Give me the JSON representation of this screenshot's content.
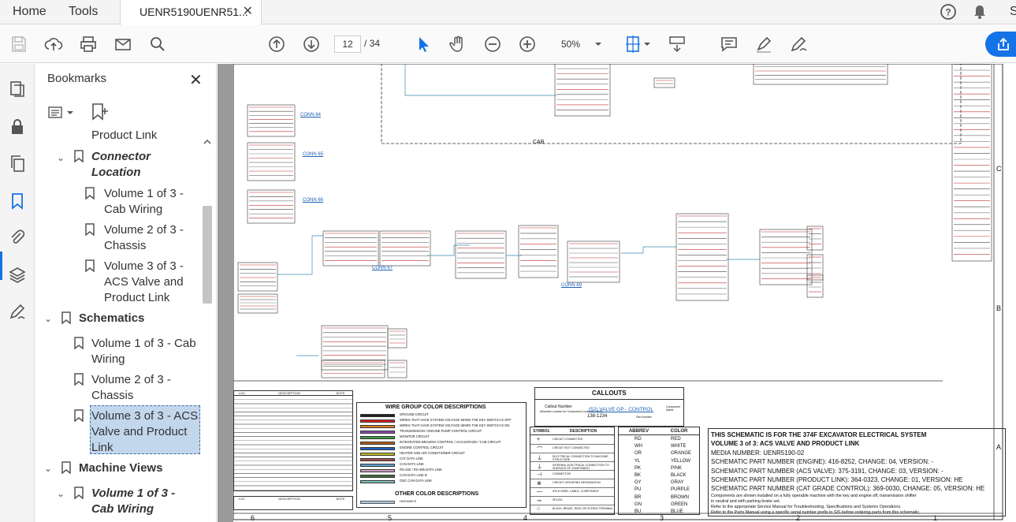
{
  "tabs": {
    "home": "Home",
    "tools": "Tools",
    "document": "UENR5190UENR51...",
    "close": "✕",
    "user_initial": "S"
  },
  "toolbar": {
    "page_current": "12",
    "page_total": "/ 34",
    "zoom": "50%"
  },
  "bookmarks": {
    "title": "Bookmarks",
    "close": "✕",
    "items": [
      {
        "label": "Product Link",
        "level": 2
      },
      {
        "label": "Connector Location",
        "level": 1
      },
      {
        "label": "Volume 1 of 3 - Cab Wiring",
        "level": 2
      },
      {
        "label": "Volume 2 of 3 - Chassis",
        "level": 2
      },
      {
        "label": "Volume 3 of 3 - ACS Valve and Product Link",
        "level": 2
      },
      {
        "label": "Schematics",
        "level": 0
      },
      {
        "label": "Volume 1 of 3 - Cab Wiring",
        "level": 1
      },
      {
        "label": "Volume 2 of 3 - Chassis",
        "level": 1
      },
      {
        "label": "Volume 3 of 3 - ACS Valve and Product Link",
        "level": 1
      },
      {
        "label": "Machine Views",
        "level": 0
      },
      {
        "label": "Volume 1 of 3 - Cab Wiring",
        "level": 1
      }
    ]
  },
  "schematic": {
    "cab_label": "CAB",
    "conn_labels": [
      "CONN 64",
      "CONN 65",
      "CONN 66",
      "CONN 67",
      "CONN 69"
    ],
    "wire_group_title": "WIRE GROUP COLOR DESCRIPTIONS",
    "wire_groups": [
      "GROUND CIRCUIT",
      "WIRES THAT HAVE SYSTEM VOLTAGE WHEN THE KEY SWITCH IS OFF",
      "WIRES THAT HAVE SYSTEM VOLTAGE WHEN THE KEY SWITCH IS ON",
      "TRANSMISSION / ENGINE PUMP CONTROL CIRCUIT",
      "MONITOR CIRCUIT",
      "INTEGRATED BRAKING CONTROL / ACCUGRADE / CAB CIRCUIT",
      "ENGINE CONTROL CIRCUIT",
      "HEATER AND AIR CONDITIONER CIRCUIT",
      "CAT DATA LINK",
      "CAN DATA LINK",
      "RS-232 / RS-485 DATA LINK",
      "CAN DATA LINK B",
      "OSC CAN DATA LINK"
    ],
    "other_color_title": "OTHER COLOR DESCRIPTIONS",
    "other_colors": [
      "HIGHWAYS"
    ],
    "callouts_title": "CALLOUTS",
    "callout_number": "Callout Number",
    "callout_sub": "(Machine Location for Component Locations Table)",
    "callout_example": "(52) VALVE GP - CONTROL",
    "callout_part": "138-1234",
    "callout_part_label": "Part Number",
    "callout_component": "Component Name",
    "symbol_headers": [
      "SYMBOL",
      "DESCRIPTION"
    ],
    "symbols": [
      "CIRCUIT CONNECTED",
      "CIRCUIT NOT CONNECTED",
      "ELECTRICAL CONNECTION TO MACHINE STRUCTURE",
      "INTERNAL ELECTRICAL CONNECTION TO SURFACE OF COMPONENT",
      "CONNECTOR",
      "CIRCUIT GROUPING DESIGNATION",
      "ATCH WIRE, CABLE, COMPONENT",
      "SPLICE",
      "BLACK, BRAZE, RING OR SCREW TERMINAL"
    ],
    "abbrev_headers": [
      "ABBREV",
      "COLOR"
    ],
    "abbrevs": [
      [
        "RD",
        "RED"
      ],
      [
        "WH",
        "WHITE"
      ],
      [
        "OR",
        "ORANGE"
      ],
      [
        "YL",
        "YELLOW"
      ],
      [
        "PK",
        "PINK"
      ],
      [
        "BK",
        "BLACK"
      ],
      [
        "GY",
        "GRAY"
      ],
      [
        "PU",
        "PURPLE"
      ],
      [
        "BR",
        "BROWN"
      ],
      [
        "GN",
        "GREEN"
      ],
      [
        "BU",
        "BLUE"
      ]
    ],
    "info_lines": [
      "THIS SCHEMATIC IS FOR THE 374F EXCAVATOR ELECTRICAL SYSTEM",
      "VOLUME 3 of 3: ACS VALVE AND PRODUCT LINK",
      "MEDIA NUMBER: UENR5190-02",
      "SCHEMATIC PART NUMBER (ENGINE): 416-8252, CHANGE: 04, VERSION: -",
      "SCHEMATIC PART NUMBER (ACS VALVE): 375-3191, CHANGE: 03, VERSION: -",
      "SCHEMATIC PART NUMBER (PRODUCT LINK): 364-0323, CHANGE: 01, VERSION: HE",
      "SCHEMATIC PART NUMBER (CAT GRADE CONTROL): 369-0030, CHANGE: 05, VERSION: HE"
    ],
    "info_notes": [
      "Components are shown installed on a fully operable machine with the key and engine off, transmission shifter",
      "in neutral and with parking brake set.",
      "Refer to the appropriate Service Manual for Troubleshooting, Specifications and Systems Operations.",
      "Refer to the Parts Manual using a specific serial number prefix in SIS before ordering parts from this schematic."
    ],
    "zone_letters": [
      "C",
      "B",
      "A"
    ],
    "zone_numbers": [
      "6",
      "5",
      "4",
      "3",
      "2",
      "1"
    ],
    "loc_headers": [
      "LOC",
      "DESCRIPTION",
      "NOTE"
    ],
    "loc_footer": [
      "LOC",
      "DESCRIPTION",
      "NOTE"
    ]
  },
  "colors": {
    "accent": "#1473e6",
    "selection": "#c3d7ec",
    "wire_link": "#1a5fb4"
  }
}
